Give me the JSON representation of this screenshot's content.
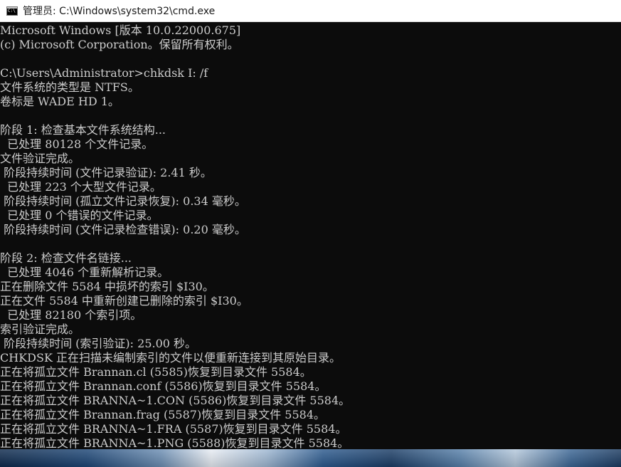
{
  "window": {
    "title": "管理员: C:\\Windows\\system32\\cmd.exe",
    "icon": "cmd-icon"
  },
  "console": {
    "lines": [
      "Microsoft Windows [版本 10.0.22000.675]",
      "(c) Microsoft Corporation。保留所有权利。",
      "",
      "C:\\Users\\Administrator>chkdsk I: /f",
      "文件系统的类型是 NTFS。",
      "卷标是 WADE HD 1。",
      "",
      "阶段 1: 检查基本文件系统结构...",
      "  已处理 80128 个文件记录。",
      "文件验证完成。",
      " 阶段持续时间 (文件记录验证): 2.41 秒。",
      "  已处理 223 个大型文件记录。",
      " 阶段持续时间 (孤立文件记录恢复): 0.34 毫秒。",
      "  已处理 0 个错误的文件记录。",
      " 阶段持续时间 (文件记录检查错误): 0.20 毫秒。",
      "",
      "阶段 2: 检查文件名链接...",
      "  已处理 4046 个重新解析记录。",
      "正在删除文件 5584 中损坏的索引 $I30。",
      "正在文件 5584 中重新创建已删除的索引 $I30。",
      "  已处理 82180 个索引项。",
      "索引验证完成。",
      " 阶段持续时间 (索引验证): 25.00 秒。",
      "CHKDSK 正在扫描未编制索引的文件以便重新连接到其原始目录。",
      "正在将孤立文件 Brannan.cl (5585)恢复到目录文件 5584。",
      "正在将孤立文件 Brannan.conf (5586)恢复到目录文件 5584。",
      "正在将孤立文件 BRANNA~1.CON (5586)恢复到目录文件 5584。",
      "正在将孤立文件 Brannan.frag (5587)恢复到目录文件 5584。",
      "正在将孤立文件 BRANNA~1.FRA (5587)恢复到目录文件 5584。",
      "正在将孤立文件 BRANNA~1.PNG (5588)恢复到目录文件 5584。"
    ]
  },
  "colors": {
    "console_background": "#0c0c0c",
    "console_text": "#cccccc",
    "titlebar_background": "#ffffff"
  }
}
